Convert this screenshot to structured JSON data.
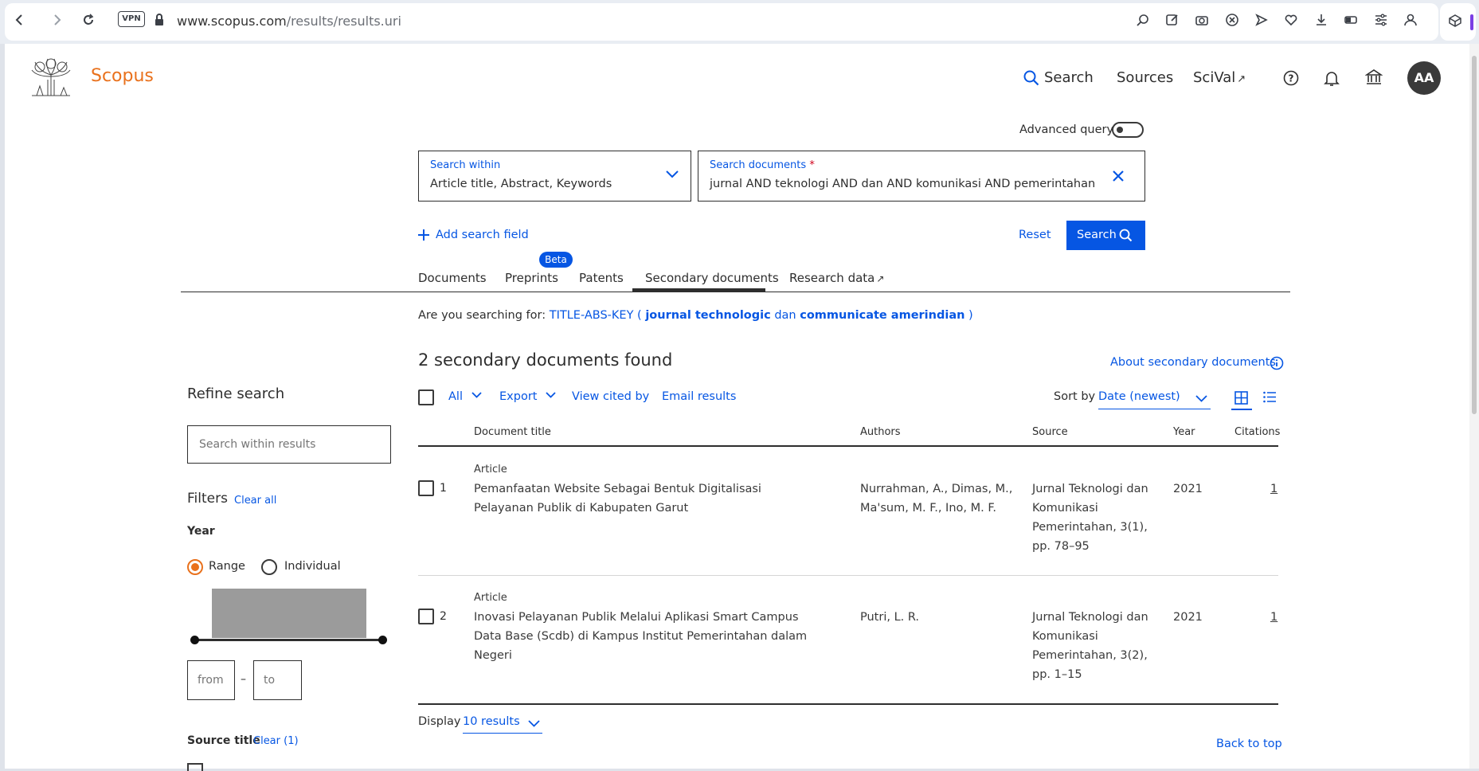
{
  "browser": {
    "url_host": "www.scopus.com",
    "url_path": "/results/results.uri",
    "vpn_label": "VPN"
  },
  "header": {
    "brand": "Scopus",
    "nav": {
      "search": "Search",
      "sources": "Sources",
      "scival": "SciVal"
    },
    "avatar_initials": "AA"
  },
  "search": {
    "advanced_query_label": "Advanced query",
    "within_label": "Search within",
    "within_value": "Article title, Abstract, Keywords",
    "documents_label": "Search documents",
    "required_marker": "*",
    "documents_value": "jurnal AND teknologi AND dan AND komunikasi AND pemerintahan",
    "add_field": "Add search field",
    "reset": "Reset",
    "search_button": "Search"
  },
  "tabs": [
    {
      "label": "Documents"
    },
    {
      "label": "Preprints",
      "badge": "Beta"
    },
    {
      "label": "Patents"
    },
    {
      "label": "Secondary documents",
      "active": true
    },
    {
      "label": "Research data"
    }
  ],
  "suggestion": {
    "prefix": "Are you searching for:",
    "query_start": "TITLE-ABS-KEY (",
    "term1": "journal technologic",
    "connector": "dan",
    "term2": "communicate amerindian",
    "query_end": ")"
  },
  "results": {
    "count_text": "2 secondary documents found",
    "about_link": "About secondary documents",
    "toolbar": {
      "all": "All",
      "export": "Export",
      "view_cited_by": "View cited by",
      "email_results": "Email results"
    },
    "sort_label": "Sort by",
    "sort_value": "Date (newest)",
    "columns": {
      "title": "Document title",
      "authors": "Authors",
      "source": "Source",
      "year": "Year",
      "citations": "Citations"
    },
    "rows": [
      {
        "index": "1",
        "type": "Article",
        "title": "Pemanfaatan Website Sebagai Bentuk Digitalisasi Pelayanan Publik di Kabupaten Garut",
        "authors": "Nurrahman, A., Dimas, M., Ma'sum, M. F., Ino, M. F.",
        "source": "Jurnal Teknologi dan Komunikasi Pemerintahan, 3(1), pp. 78–95",
        "year": "2021",
        "citations": "1"
      },
      {
        "index": "2",
        "type": "Article",
        "title": "Inovasi Pelayanan Publik Melalui Aplikasi Smart Campus Data Base (Scdb) di Kampus Institut Pemerintahan dalam Negeri",
        "authors": "Putri, L. R.",
        "source": "Jurnal Teknologi dan Komunikasi Pemerintahan, 3(2), pp. 1–15",
        "year": "2021",
        "citations": "1"
      }
    ],
    "display_label": "Display",
    "display_value": "10 results",
    "back_to_top": "Back to top"
  },
  "refine": {
    "heading": "Refine search",
    "search_placeholder": "Search within results",
    "filters_label": "Filters",
    "clear_all": "Clear all",
    "year_label": "Year",
    "range_label": "Range",
    "individual_label": "Individual",
    "from_placeholder": "from",
    "dash": "–",
    "to_placeholder": "to",
    "source_title_label": "Source title",
    "source_clear": "Clear (1)"
  },
  "colors": {
    "accent": "#0656e3",
    "brand_orange": "#e9711c",
    "radio_selected": "#e9711c",
    "tab_active_underline": "#2e2e2e"
  }
}
